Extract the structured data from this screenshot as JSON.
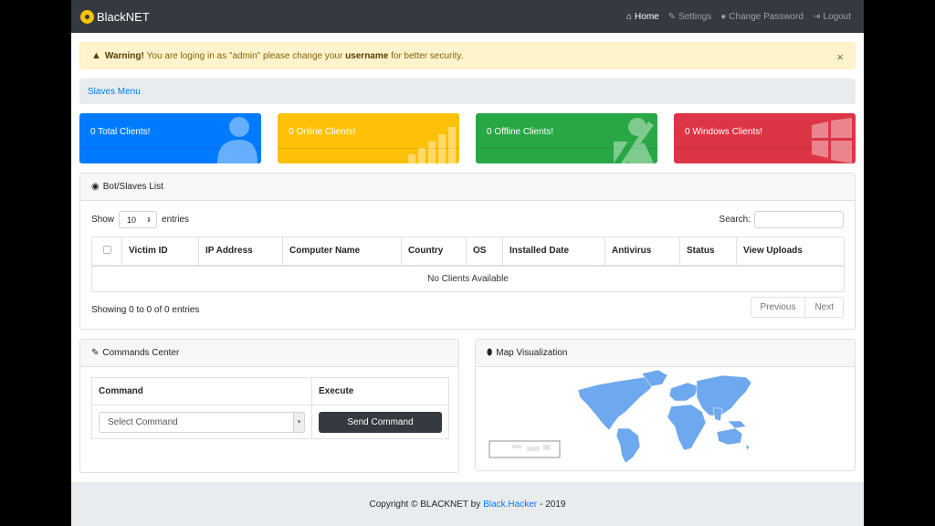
{
  "navbar": {
    "brand": "BlackNET",
    "items": [
      {
        "icon": "home-icon",
        "label": "Home"
      },
      {
        "icon": "wrench-icon",
        "label": "Settings"
      },
      {
        "icon": "user-icon",
        "label": "Change Password"
      },
      {
        "icon": "sign-out-icon",
        "label": "Logout"
      }
    ]
  },
  "alert": {
    "strong": "Warning!",
    "text_before": "You are loging in as \"admin\" please change your",
    "username": "username",
    "text_after": "for better security.",
    "close": "×"
  },
  "breadcrumb": {
    "label": "Slaves Menu"
  },
  "stats": [
    {
      "label": "0 Total Clients!",
      "color": "#007bff",
      "icon": "users-icon"
    },
    {
      "label": "0 Online Clients!",
      "color": "#ffc107",
      "icon": "signal-icon"
    },
    {
      "label": "0 Offline Clients!",
      "color": "#28a745",
      "icon": "no-signal-icon"
    },
    {
      "label": "0 Windows Clients!",
      "color": "#dc3545",
      "icon": "windows-icon"
    }
  ],
  "bots_panel": {
    "title": "Bot/Slaves List",
    "show_label": "Show",
    "entries_value": "10",
    "entries_label": "entries",
    "search_label": "Search:",
    "columns": [
      "Victim ID",
      "IP Address",
      "Computer Name",
      "Country",
      "OS",
      "Installed Date",
      "Antivirus",
      "Status",
      "View Uploads"
    ],
    "empty_message": "No Clients Available",
    "info": "Showing 0 to 0 of 0 entries",
    "prev": "Previous",
    "next": "Next"
  },
  "commands_panel": {
    "title": "Commands Center",
    "col_command": "Command",
    "col_execute": "Execute",
    "select_placeholder": "Select Command",
    "button": "Send Command"
  },
  "map_panel": {
    "title": "Map Visualization"
  },
  "footer": {
    "prefix": "Copyright © BLACKNET by",
    "link": "Black.Hacker",
    "suffix": "- 2019"
  },
  "colors": {
    "map_land": "#6ea8ee",
    "navbar": "#343a40"
  }
}
